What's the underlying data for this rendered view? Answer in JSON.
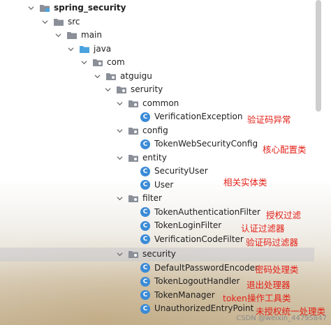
{
  "tree": [
    {
      "label": "spring_security",
      "icon": "project-folder-icon",
      "bold": true
    },
    {
      "label": "src",
      "icon": "folder-icon"
    },
    {
      "label": "main",
      "icon": "folder-icon"
    },
    {
      "label": "java",
      "icon": "source-folder-icon"
    },
    {
      "label": "com",
      "icon": "package-icon"
    },
    {
      "label": "atguigu",
      "icon": "package-icon"
    },
    {
      "label": "serurity",
      "icon": "package-icon"
    },
    {
      "label": "common",
      "icon": "package-icon"
    },
    {
      "label": "VerificationException",
      "icon": "class-icon"
    },
    {
      "label": "config",
      "icon": "package-icon"
    },
    {
      "label": "TokenWebSecurityConfig",
      "icon": "class-icon"
    },
    {
      "label": "entity",
      "icon": "package-icon"
    },
    {
      "label": "SecurityUser",
      "icon": "class-icon"
    },
    {
      "label": "User",
      "icon": "class-icon"
    },
    {
      "label": "filter",
      "icon": "package-icon"
    },
    {
      "label": "TokenAuthenticationFilter",
      "icon": "class-icon"
    },
    {
      "label": "TokenLoginFilter",
      "icon": "class-icon"
    },
    {
      "label": "VerificationCodeFilter",
      "icon": "class-icon"
    },
    {
      "label": "security",
      "icon": "package-icon",
      "selected": true
    },
    {
      "label": "DefaultPasswordEncoder",
      "icon": "class-icon"
    },
    {
      "label": "TokenLogoutHandler",
      "icon": "class-icon"
    },
    {
      "label": "TokenManager",
      "icon": "class-icon"
    },
    {
      "label": "UnauthorizedEntryPoint",
      "icon": "class-icon"
    }
  ],
  "annotations": {
    "verification_exception": "验证码异常",
    "core_config": "核心配置类",
    "entity": "相关实体类",
    "auth_filter": "授权过滤",
    "login_filter": "认证过滤器",
    "code_filter": "验证码过滤器",
    "password": "密码处理类",
    "logout": "退出处理器",
    "token_manager": "token操作工具类",
    "unauthorized": "未授权统一处理类"
  },
  "watermark": "CSDN @weixin_44795847",
  "colors": {
    "annotation": "#e32119",
    "class_icon": "#3b8bd6",
    "folder": "#8a8f98",
    "source_folder": "#4aa3df",
    "selected_row": "#c8c8cd"
  }
}
